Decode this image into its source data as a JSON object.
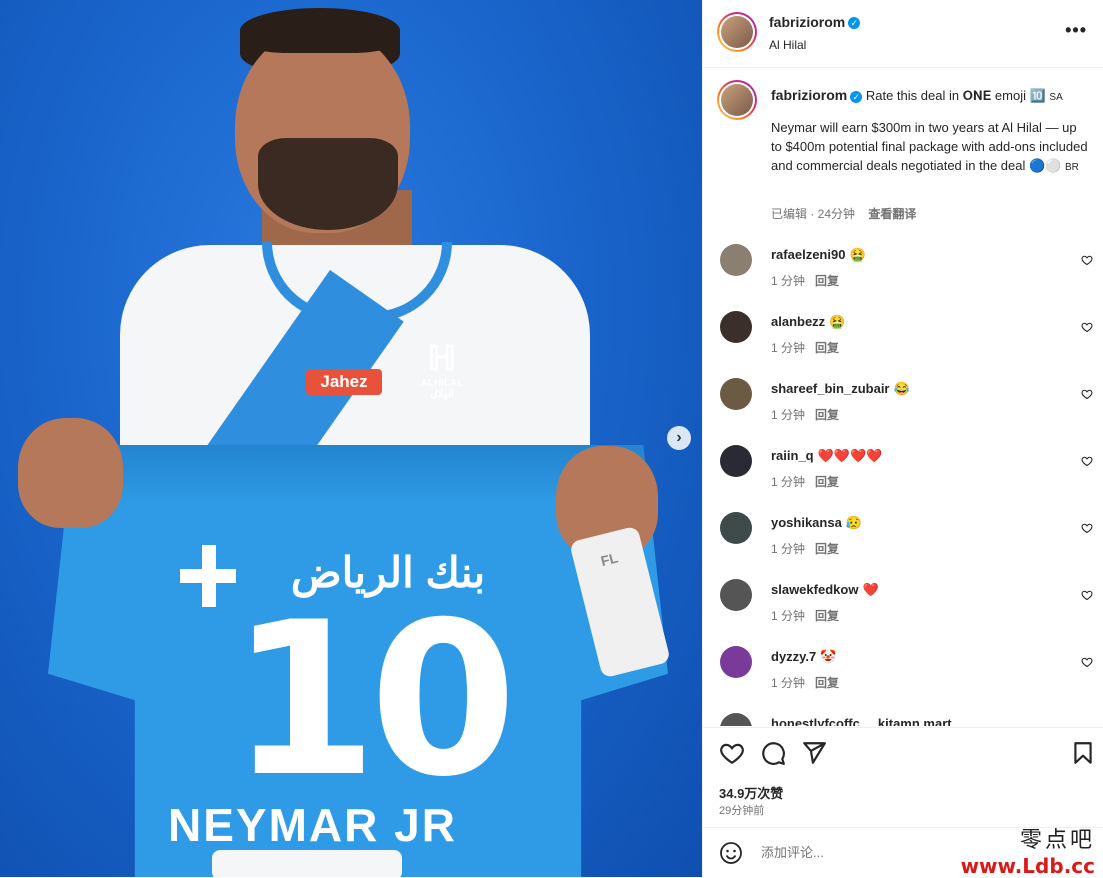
{
  "post": {
    "author": "fabriziorom",
    "location": "Al Hilal"
  },
  "caption": {
    "author": "fabriziorom",
    "line1": "Rate this deal in 𝐎𝐍𝐄 emoji 🔟",
    "flag_sa": "SA",
    "body": "Neymar will earn $300m in two years at Al Hilal — up to $400m potential final package with add-ons included and commercial deals negotiated in the deal 🔵⚪",
    "flag_br": "BR",
    "edited": "已编辑 · 24分钟",
    "translate": "查看翻译"
  },
  "image": {
    "sponsor": "Jahez",
    "club_arabic_mark": "ℍ",
    "club_name": "ALHILAL",
    "club_name_ar": "الهلال",
    "shirt_arabic": "بنك الرياض",
    "shirt_number": "10",
    "shirt_name": "NEYMAR JR",
    "sleeve_text": "FL"
  },
  "comments": [
    {
      "user": "rafaelzeni90",
      "text": "🤮",
      "time": "1 分钟",
      "reply": "回复",
      "avatar_color": "#8a7f70"
    },
    {
      "user": "alanbezz",
      "text": "🤮",
      "time": "1 分钟",
      "reply": "回复",
      "avatar_color": "#3a2f2a"
    },
    {
      "user": "shareef_bin_zubair",
      "text": "😂",
      "time": "1 分钟",
      "reply": "回复",
      "avatar_color": "#6b5a44"
    },
    {
      "user": "raiin_q",
      "text": "❤️❤️❤️❤️",
      "time": "1 分钟",
      "reply": "回复",
      "avatar_color": "#2a2a35"
    },
    {
      "user": "yoshikansa",
      "text": "😥",
      "time": "1 分钟",
      "reply": "回复",
      "avatar_color": "#3f4a4a"
    },
    {
      "user": "slawekfedkow",
      "text": "❤️",
      "time": "1 分钟",
      "reply": "回复",
      "avatar_color": "#555555"
    },
    {
      "user": "dyzzy.7",
      "text": "🤡",
      "time": "1 分钟",
      "reply": "回复",
      "avatar_color": "#7a3a9a"
    }
  ],
  "partial_comment": "honestlyfcoffc ... kitamn.mart",
  "likes": "34.9万次赞",
  "posted": "29分钟前",
  "comment_placeholder": "添加评论...",
  "watermark": {
    "cn": "零点吧",
    "url": "www.Ldb.cc"
  },
  "icons": {
    "more": "more-horizontal-icon",
    "like": "heart-icon",
    "comment": "comment-icon",
    "share": "send-icon",
    "save": "bookmark-icon",
    "emoji": "smiley-icon"
  },
  "colors": {
    "verified": "#0095f6",
    "jersey_blue": "#2f9be6"
  }
}
